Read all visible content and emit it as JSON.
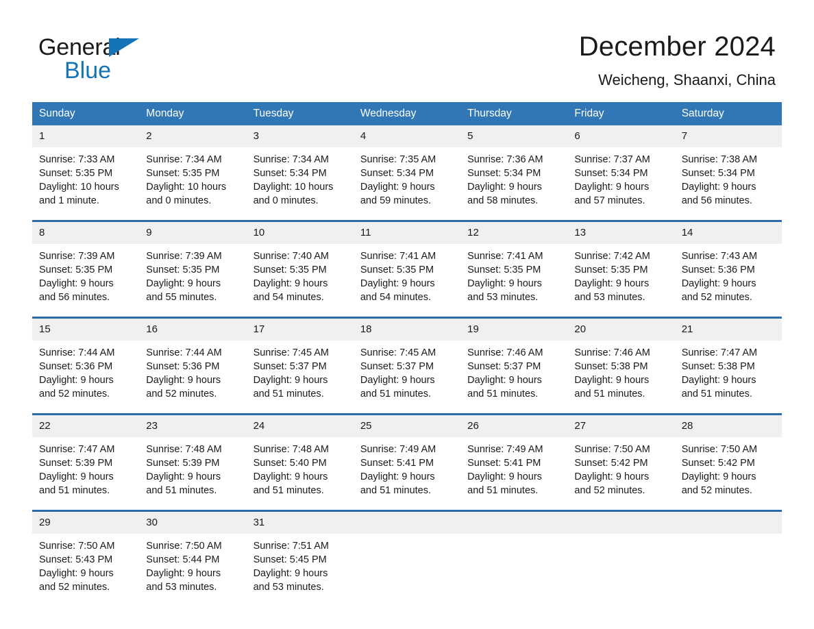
{
  "brand": {
    "name_part1": "General",
    "name_part2": "Blue",
    "triangle_color": "#1573b8"
  },
  "header": {
    "title": "December 2024",
    "location": "Weicheng, Shaanxi, China"
  },
  "theme": {
    "header_bg": "#3277b5",
    "row_border": "#2b6cad",
    "date_band_bg": "#f0f0f0",
    "page_bg": "#ffffff",
    "text": "#1a1a1a"
  },
  "weekday_headers": [
    "Sunday",
    "Monday",
    "Tuesday",
    "Wednesday",
    "Thursday",
    "Friday",
    "Saturday"
  ],
  "labels": {
    "sunrise_prefix": "Sunrise:",
    "sunset_prefix": "Sunset:",
    "daylight_prefix": "Daylight:"
  },
  "weeks": [
    [
      {
        "day": "1",
        "sunrise": "Sunrise: 7:33 AM",
        "sunset": "Sunset: 5:35 PM",
        "daylight_1": "Daylight: 10 hours",
        "daylight_2": "and 1 minute."
      },
      {
        "day": "2",
        "sunrise": "Sunrise: 7:34 AM",
        "sunset": "Sunset: 5:35 PM",
        "daylight_1": "Daylight: 10 hours",
        "daylight_2": "and 0 minutes."
      },
      {
        "day": "3",
        "sunrise": "Sunrise: 7:34 AM",
        "sunset": "Sunset: 5:34 PM",
        "daylight_1": "Daylight: 10 hours",
        "daylight_2": "and 0 minutes."
      },
      {
        "day": "4",
        "sunrise": "Sunrise: 7:35 AM",
        "sunset": "Sunset: 5:34 PM",
        "daylight_1": "Daylight: 9 hours",
        "daylight_2": "and 59 minutes."
      },
      {
        "day": "5",
        "sunrise": "Sunrise: 7:36 AM",
        "sunset": "Sunset: 5:34 PM",
        "daylight_1": "Daylight: 9 hours",
        "daylight_2": "and 58 minutes."
      },
      {
        "day": "6",
        "sunrise": "Sunrise: 7:37 AM",
        "sunset": "Sunset: 5:34 PM",
        "daylight_1": "Daylight: 9 hours",
        "daylight_2": "and 57 minutes."
      },
      {
        "day": "7",
        "sunrise": "Sunrise: 7:38 AM",
        "sunset": "Sunset: 5:34 PM",
        "daylight_1": "Daylight: 9 hours",
        "daylight_2": "and 56 minutes."
      }
    ],
    [
      {
        "day": "8",
        "sunrise": "Sunrise: 7:39 AM",
        "sunset": "Sunset: 5:35 PM",
        "daylight_1": "Daylight: 9 hours",
        "daylight_2": "and 56 minutes."
      },
      {
        "day": "9",
        "sunrise": "Sunrise: 7:39 AM",
        "sunset": "Sunset: 5:35 PM",
        "daylight_1": "Daylight: 9 hours",
        "daylight_2": "and 55 minutes."
      },
      {
        "day": "10",
        "sunrise": "Sunrise: 7:40 AM",
        "sunset": "Sunset: 5:35 PM",
        "daylight_1": "Daylight: 9 hours",
        "daylight_2": "and 54 minutes."
      },
      {
        "day": "11",
        "sunrise": "Sunrise: 7:41 AM",
        "sunset": "Sunset: 5:35 PM",
        "daylight_1": "Daylight: 9 hours",
        "daylight_2": "and 54 minutes."
      },
      {
        "day": "12",
        "sunrise": "Sunrise: 7:41 AM",
        "sunset": "Sunset: 5:35 PM",
        "daylight_1": "Daylight: 9 hours",
        "daylight_2": "and 53 minutes."
      },
      {
        "day": "13",
        "sunrise": "Sunrise: 7:42 AM",
        "sunset": "Sunset: 5:35 PM",
        "daylight_1": "Daylight: 9 hours",
        "daylight_2": "and 53 minutes."
      },
      {
        "day": "14",
        "sunrise": "Sunrise: 7:43 AM",
        "sunset": "Sunset: 5:36 PM",
        "daylight_1": "Daylight: 9 hours",
        "daylight_2": "and 52 minutes."
      }
    ],
    [
      {
        "day": "15",
        "sunrise": "Sunrise: 7:44 AM",
        "sunset": "Sunset: 5:36 PM",
        "daylight_1": "Daylight: 9 hours",
        "daylight_2": "and 52 minutes."
      },
      {
        "day": "16",
        "sunrise": "Sunrise: 7:44 AM",
        "sunset": "Sunset: 5:36 PM",
        "daylight_1": "Daylight: 9 hours",
        "daylight_2": "and 52 minutes."
      },
      {
        "day": "17",
        "sunrise": "Sunrise: 7:45 AM",
        "sunset": "Sunset: 5:37 PM",
        "daylight_1": "Daylight: 9 hours",
        "daylight_2": "and 51 minutes."
      },
      {
        "day": "18",
        "sunrise": "Sunrise: 7:45 AM",
        "sunset": "Sunset: 5:37 PM",
        "daylight_1": "Daylight: 9 hours",
        "daylight_2": "and 51 minutes."
      },
      {
        "day": "19",
        "sunrise": "Sunrise: 7:46 AM",
        "sunset": "Sunset: 5:37 PM",
        "daylight_1": "Daylight: 9 hours",
        "daylight_2": "and 51 minutes."
      },
      {
        "day": "20",
        "sunrise": "Sunrise: 7:46 AM",
        "sunset": "Sunset: 5:38 PM",
        "daylight_1": "Daylight: 9 hours",
        "daylight_2": "and 51 minutes."
      },
      {
        "day": "21",
        "sunrise": "Sunrise: 7:47 AM",
        "sunset": "Sunset: 5:38 PM",
        "daylight_1": "Daylight: 9 hours",
        "daylight_2": "and 51 minutes."
      }
    ],
    [
      {
        "day": "22",
        "sunrise": "Sunrise: 7:47 AM",
        "sunset": "Sunset: 5:39 PM",
        "daylight_1": "Daylight: 9 hours",
        "daylight_2": "and 51 minutes."
      },
      {
        "day": "23",
        "sunrise": "Sunrise: 7:48 AM",
        "sunset": "Sunset: 5:39 PM",
        "daylight_1": "Daylight: 9 hours",
        "daylight_2": "and 51 minutes."
      },
      {
        "day": "24",
        "sunrise": "Sunrise: 7:48 AM",
        "sunset": "Sunset: 5:40 PM",
        "daylight_1": "Daylight: 9 hours",
        "daylight_2": "and 51 minutes."
      },
      {
        "day": "25",
        "sunrise": "Sunrise: 7:49 AM",
        "sunset": "Sunset: 5:41 PM",
        "daylight_1": "Daylight: 9 hours",
        "daylight_2": "and 51 minutes."
      },
      {
        "day": "26",
        "sunrise": "Sunrise: 7:49 AM",
        "sunset": "Sunset: 5:41 PM",
        "daylight_1": "Daylight: 9 hours",
        "daylight_2": "and 51 minutes."
      },
      {
        "day": "27",
        "sunrise": "Sunrise: 7:50 AM",
        "sunset": "Sunset: 5:42 PM",
        "daylight_1": "Daylight: 9 hours",
        "daylight_2": "and 52 minutes."
      },
      {
        "day": "28",
        "sunrise": "Sunrise: 7:50 AM",
        "sunset": "Sunset: 5:42 PM",
        "daylight_1": "Daylight: 9 hours",
        "daylight_2": "and 52 minutes."
      }
    ],
    [
      {
        "day": "29",
        "sunrise": "Sunrise: 7:50 AM",
        "sunset": "Sunset: 5:43 PM",
        "daylight_1": "Daylight: 9 hours",
        "daylight_2": "and 52 minutes."
      },
      {
        "day": "30",
        "sunrise": "Sunrise: 7:50 AM",
        "sunset": "Sunset: 5:44 PM",
        "daylight_1": "Daylight: 9 hours",
        "daylight_2": "and 53 minutes."
      },
      {
        "day": "31",
        "sunrise": "Sunrise: 7:51 AM",
        "sunset": "Sunset: 5:45 PM",
        "daylight_1": "Daylight: 9 hours",
        "daylight_2": "and 53 minutes."
      },
      {
        "day": "",
        "sunrise": "",
        "sunset": "",
        "daylight_1": "",
        "daylight_2": ""
      },
      {
        "day": "",
        "sunrise": "",
        "sunset": "",
        "daylight_1": "",
        "daylight_2": ""
      },
      {
        "day": "",
        "sunrise": "",
        "sunset": "",
        "daylight_1": "",
        "daylight_2": ""
      },
      {
        "day": "",
        "sunrise": "",
        "sunset": "",
        "daylight_1": "",
        "daylight_2": ""
      }
    ]
  ]
}
